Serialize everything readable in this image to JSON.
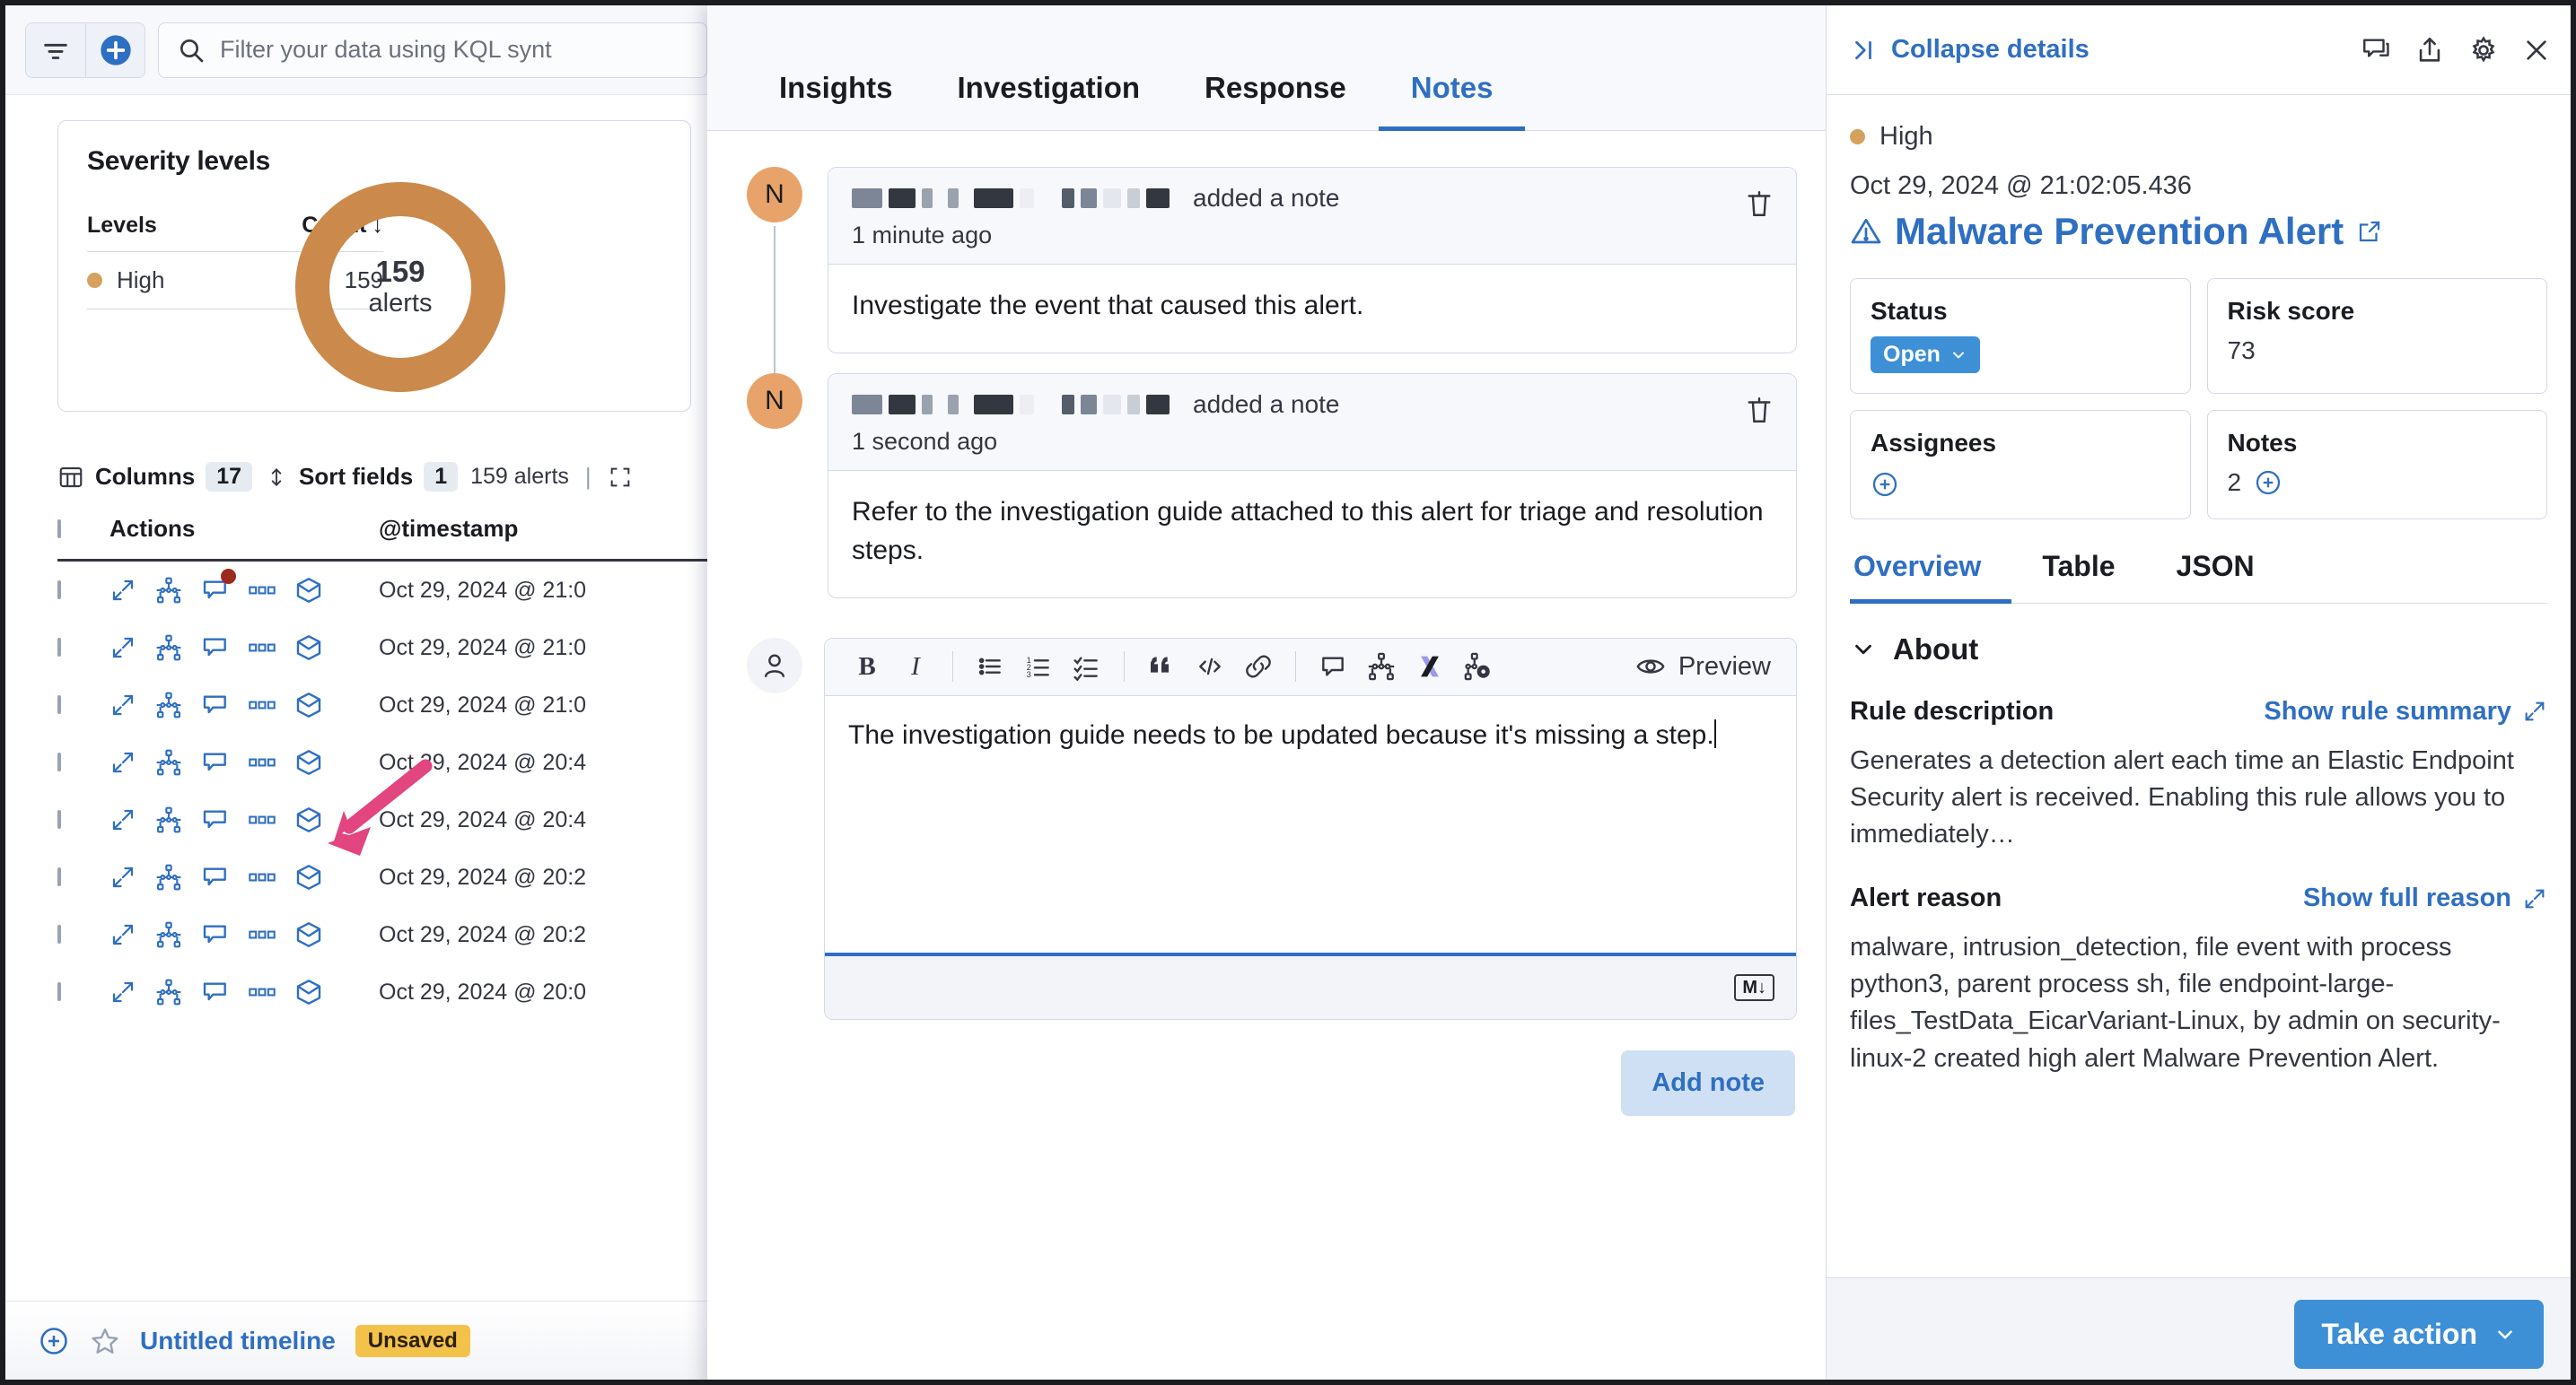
{
  "left": {
    "search": {
      "placeholder": "Filter your data using KQL synt",
      "icon": "search-icon"
    },
    "filter_icon": "filter-icon",
    "add_icon": "plus-circle-icon",
    "severity_card": {
      "title": "Severity levels",
      "columns": [
        "Levels",
        "Count"
      ],
      "sort_arrow": "↓",
      "rows": [
        {
          "level": "High",
          "count": "159",
          "color": "#d6a15e"
        }
      ],
      "donut_center_value": "159",
      "donut_center_label": "alerts"
    },
    "table_toolbar": {
      "columns_label": "Columns",
      "columns_count": "17",
      "sort_fields_label": "Sort fields",
      "sort_fields_count": "1",
      "alerts_count_label": "159 alerts"
    },
    "table": {
      "headers": [
        "Actions",
        "@timestamp"
      ],
      "row_action_icons": [
        "expand-icon",
        "analyzer-icon",
        "note-icon",
        "session-icon",
        "cases-icon"
      ],
      "rows": [
        {
          "timestamp": "Oct 29, 2024 @ 21:0",
          "has_note": true
        },
        {
          "timestamp": "Oct 29, 2024 @ 21:0",
          "has_note": false
        },
        {
          "timestamp": "Oct 29, 2024 @ 21:0",
          "has_note": false
        },
        {
          "timestamp": "Oct 29, 2024 @ 20:4",
          "has_note": false
        },
        {
          "timestamp": "Oct 29, 2024 @ 20:4",
          "has_note": false
        },
        {
          "timestamp": "Oct 29, 2024 @ 20:2",
          "has_note": false
        },
        {
          "timestamp": "Oct 29, 2024 @ 20:2",
          "has_note": false
        },
        {
          "timestamp": "Oct 29, 2024 @ 20:0",
          "has_note": false
        }
      ]
    },
    "timeline_bar": {
      "add_icon": "plus-circle-icon",
      "favorite_icon": "star-icon",
      "title": "Untitled timeline",
      "badge": "Unsaved"
    }
  },
  "middle": {
    "tabs": [
      {
        "label": "Insights",
        "active": false
      },
      {
        "label": "Investigation",
        "active": false
      },
      {
        "label": "Response",
        "active": false
      },
      {
        "label": "Notes",
        "active": true
      }
    ],
    "notes": [
      {
        "avatar": "N",
        "action": "added a note",
        "time": "1 minute ago",
        "text": "Investigate the event that caused this alert.",
        "delete_icon": "trash-icon"
      },
      {
        "avatar": "N",
        "action": "added a note",
        "time": "1 second ago",
        "text": "Refer to the investigation guide attached to this alert for triage and resolution steps.",
        "delete_icon": "trash-icon"
      }
    ],
    "editor": {
      "avatar_icon": "user-icon",
      "toolbar": [
        {
          "name": "bold-icon",
          "glyph": "B"
        },
        {
          "name": "italic-icon",
          "glyph": "I"
        },
        {
          "name": "bullet-list-icon",
          "glyph": ""
        },
        {
          "name": "ordered-list-icon",
          "glyph": ""
        },
        {
          "name": "checklist-icon",
          "glyph": ""
        },
        {
          "name": "quote-icon",
          "glyph": "“"
        },
        {
          "name": "code-icon",
          "glyph": "</>"
        },
        {
          "name": "link-icon",
          "glyph": ""
        },
        {
          "name": "timeline-icon",
          "glyph": ""
        },
        {
          "name": "analyzer-icon",
          "glyph": ""
        },
        {
          "name": "osquery-icon",
          "glyph": ""
        },
        {
          "name": "session-view-icon",
          "glyph": ""
        }
      ],
      "preview_label": "Preview",
      "preview_icon": "eye-icon",
      "value": "The investigation guide needs to be updated because it's missing a step.",
      "markdown_badge": "M↓"
    },
    "add_note_label": "Add note"
  },
  "right": {
    "collapse_label": "Collapse details",
    "collapse_icon": "collapse-right-icon",
    "header_icons": [
      "comment-icon",
      "share-icon",
      "gear-icon",
      "close-icon"
    ],
    "severity": "High",
    "severity_color": "#d6a15e",
    "timestamp": "Oct 29, 2024 @ 21:02:05.436",
    "alert_title": "Malware Prevention Alert",
    "alert_title_icon": "warning-icon",
    "alert_title_external_icon": "external-link-icon",
    "cells": [
      {
        "label": "Status",
        "type": "status",
        "value": "Open"
      },
      {
        "label": "Risk score",
        "type": "text",
        "value": "73"
      },
      {
        "label": "Assignees",
        "type": "add",
        "value": ""
      },
      {
        "label": "Notes",
        "type": "count-add",
        "value": "2"
      }
    ],
    "tabs": [
      {
        "label": "Overview",
        "active": true
      },
      {
        "label": "Table",
        "active": false
      },
      {
        "label": "JSON",
        "active": false
      }
    ],
    "about": {
      "section_label": "About",
      "chevron_icon": "chevron-down-icon",
      "rule_description_label": "Rule description",
      "rule_description_link": "Show rule summary",
      "rule_description_text": "Generates a detection alert each time an Elastic Endpoint Security alert is received. Enabling this rule allows you to immediately…",
      "alert_reason_label": "Alert reason",
      "alert_reason_link": "Show full reason",
      "alert_reason_text": "malware, intrusion_detection, file event with process python3, parent process sh, file endpoint-large-files_TestData_EicarVariant-Linux, by admin on security-linux-2 created high alert Malware Prevention Alert."
    },
    "take_action_label": "Take action",
    "take_action_chevron": "chevron-down-icon"
  }
}
